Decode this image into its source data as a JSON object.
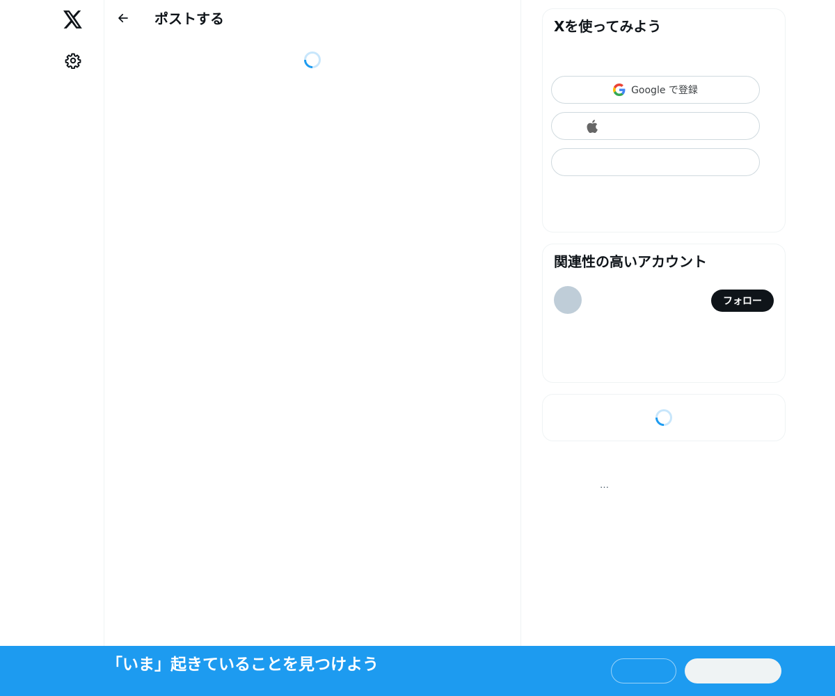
{
  "header": {
    "title": "ポストする"
  },
  "icons": {
    "logo": "x-logo-icon",
    "settings": "gear-icon",
    "back": "arrow-left-icon",
    "google": "google-icon",
    "apple": "apple-icon"
  },
  "signup_card": {
    "title": "Xを使ってみよう",
    "google_label": "Google で登録",
    "apple_label": "",
    "create_label": ""
  },
  "accounts_card": {
    "title": "関連性の高いアカウント",
    "follow_label": "フォロー"
  },
  "footer": {
    "more": "…"
  },
  "bottom_bar": {
    "title": "「いま」起きていることを見つけよう",
    "login_label": "",
    "signup_label": ""
  },
  "colors": {
    "accent": "#1d9bf0",
    "text": "#0f1419",
    "border": "#eff3f4",
    "follow_bg": "#0f1419"
  }
}
